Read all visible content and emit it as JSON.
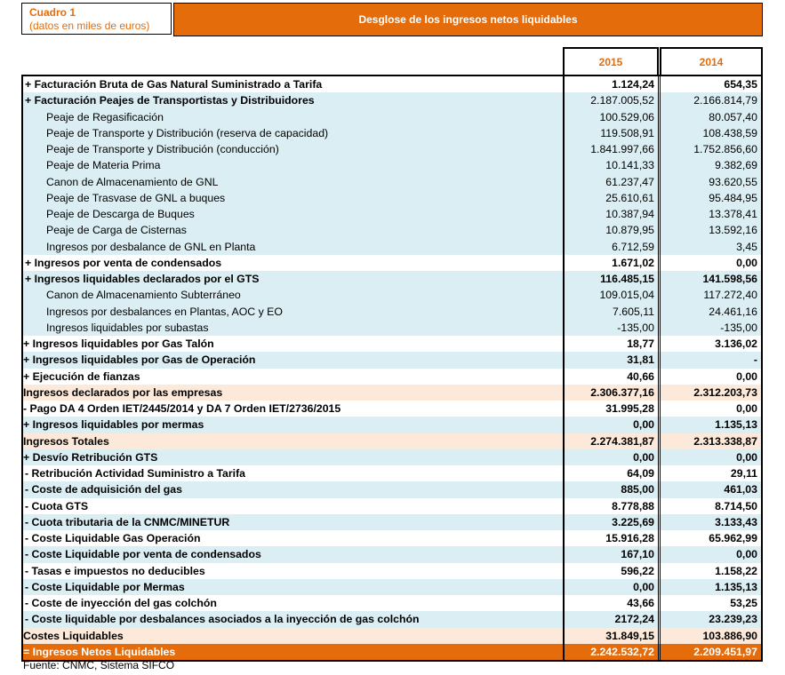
{
  "header": {
    "box_title": "Cuadro 1",
    "box_subtitle": "(datos en miles de euros)",
    "title": "Desglose de los ingresos netos liquidables"
  },
  "columns": [
    "2015",
    "2014"
  ],
  "rows": [
    {
      "label": "+ Facturación Bruta de Gas Natural Suministrado a Tarifa",
      "v2015": "1.124,24",
      "v2014": "654,35",
      "bold": true,
      "indent": 1,
      "bg": "white"
    },
    {
      "label": "+ Facturación Peajes de Transportistas y Distribuidores",
      "v2015": "2.187.005,52",
      "v2014": "2.166.814,79",
      "bold": true,
      "indent": 1,
      "bg": "blue",
      "vbold": false
    },
    {
      "label": "Peaje de Regasificación",
      "v2015": "100.529,06",
      "v2014": "80.057,40",
      "bold": false,
      "indent": 2,
      "bg": "blue"
    },
    {
      "label": "Peaje de Transporte y Distribución (reserva de capacidad)",
      "v2015": "119.508,91",
      "v2014": "108.438,59",
      "bold": false,
      "indent": 2,
      "bg": "blue"
    },
    {
      "label": "Peaje de Transporte y Distribución (conducción)",
      "v2015": "1.841.997,66",
      "v2014": "1.752.856,60",
      "bold": false,
      "indent": 2,
      "bg": "blue"
    },
    {
      "label": "Peaje de Materia Prima",
      "v2015": "10.141,33",
      "v2014": "9.382,69",
      "bold": false,
      "indent": 2,
      "bg": "blue"
    },
    {
      "label": "Canon de Almacenamiento de GNL",
      "v2015": "61.237,47",
      "v2014": "93.620,55",
      "bold": false,
      "indent": 2,
      "bg": "blue"
    },
    {
      "label": "Peaje de Trasvase de GNL a buques",
      "v2015": "25.610,61",
      "v2014": "95.484,95",
      "bold": false,
      "indent": 2,
      "bg": "blue"
    },
    {
      "label": "Peaje de Descarga de Buques",
      "v2015": "10.387,94",
      "v2014": "13.378,41",
      "bold": false,
      "indent": 2,
      "bg": "blue"
    },
    {
      "label": "Peaje de Carga de Cisternas",
      "v2015": "10.879,95",
      "v2014": "13.592,16",
      "bold": false,
      "indent": 2,
      "bg": "blue"
    },
    {
      "label": "Ingresos por desbalance de GNL en Planta",
      "v2015": "6.712,59",
      "v2014": "3,45",
      "bold": false,
      "indent": 2,
      "bg": "blue"
    },
    {
      "label": "+ Ingresos por venta de condensados",
      "v2015": "1.671,02",
      "v2014": "0,00",
      "bold": true,
      "indent": 1,
      "bg": "white"
    },
    {
      "label": "+ Ingresos liquidables declarados por el GTS",
      "v2015": "116.485,15",
      "v2014": "141.598,56",
      "bold": true,
      "indent": 1,
      "bg": "blue"
    },
    {
      "label": "Canon de Almacenamiento Subterráneo",
      "v2015": "109.015,04",
      "v2014": "117.272,40",
      "bold": false,
      "indent": 2,
      "bg": "blue"
    },
    {
      "label": "Ingresos por desbalances en Plantas, AOC y EO",
      "v2015": "7.605,11",
      "v2014": "24.461,16",
      "bold": false,
      "indent": 2,
      "bg": "blue"
    },
    {
      "label": "Ingresos liquidables por subastas",
      "v2015": "-135,00",
      "v2014": "-135,00",
      "bold": false,
      "indent": 2,
      "bg": "blue"
    },
    {
      "label": "+ Ingresos liquidables por Gas Talón",
      "v2015": "18,77",
      "v2014": "3.136,02",
      "bold": true,
      "indent": 0,
      "bg": "white"
    },
    {
      "label": "+ Ingresos liquidables por Gas de Operación",
      "v2015": "31,81",
      "v2014": "-",
      "bold": true,
      "indent": 0,
      "bg": "blue"
    },
    {
      "label": "+ Ejecución de fianzas",
      "v2015": "40,66",
      "v2014": "0,00",
      "bold": true,
      "indent": 0,
      "bg": "white"
    },
    {
      "label": "Ingresos declarados por las empresas",
      "v2015": "2.306.377,16",
      "v2014": "2.312.203,73",
      "bold": true,
      "indent": 0,
      "bg": "peach"
    },
    {
      "label": "- Pago DA 4 Orden IET/2445/2014 y DA 7 Orden IET/2736/2015",
      "v2015": "31.995,28",
      "v2014": "0,00",
      "bold": true,
      "indent": 0,
      "bg": "white"
    },
    {
      "label": "+ Ingresos liquidables por mermas",
      "v2015": "0,00",
      "v2014": "1.135,13",
      "bold": true,
      "indent": 0,
      "bg": "blue"
    },
    {
      "label": "Ingresos Totales",
      "v2015": "2.274.381,87",
      "v2014": "2.313.338,87",
      "bold": true,
      "indent": 0,
      "bg": "peach"
    },
    {
      "label": "+ Desvío Retribución GTS",
      "v2015": "0,00",
      "v2014": "0,00",
      "bold": true,
      "indent": 0,
      "bg": "blue"
    },
    {
      "label": "- Retribución Actividad Suministro a Tarifa",
      "v2015": "64,09",
      "v2014": "29,11",
      "bold": true,
      "indent": 1,
      "bg": "white"
    },
    {
      "label": "- Coste de adquisición del gas",
      "v2015": "885,00",
      "v2014": "461,03",
      "bold": true,
      "indent": 1,
      "bg": "blue"
    },
    {
      "label": "- Cuota GTS",
      "v2015": "8.778,88",
      "v2014": "8.714,50",
      "bold": true,
      "indent": 1,
      "bg": "white"
    },
    {
      "label": "- Cuota tributaria de la CNMC/MINETUR",
      "v2015": "3.225,69",
      "v2014": "3.133,43",
      "bold": true,
      "indent": 1,
      "bg": "blue"
    },
    {
      "label": "- Coste Liquidable Gas Operación",
      "v2015": "15.916,28",
      "v2014": "65.962,99",
      "bold": true,
      "indent": 1,
      "bg": "white"
    },
    {
      "label": "- Coste Liquidable por venta de condensados",
      "v2015": "167,10",
      "v2014": "0,00",
      "bold": true,
      "indent": 1,
      "bg": "blue"
    },
    {
      "label": "- Tasas e impuestos no deducibles",
      "v2015": "596,22",
      "v2014": "1.158,22",
      "bold": true,
      "indent": 1,
      "bg": "white"
    },
    {
      "label": "- Coste Liquidable por Mermas",
      "v2015": "0,00",
      "v2014": "1.135,13",
      "bold": true,
      "indent": 1,
      "bg": "blue"
    },
    {
      "label": "- Coste de inyección del gas colchón",
      "v2015": "43,66",
      "v2014": "53,25",
      "bold": true,
      "indent": 1,
      "bg": "white"
    },
    {
      "label": "- Coste liquidable por desbalances asociados a la inyección de gas colchón",
      "v2015": "2172,24",
      "v2014": "23.239,23",
      "bold": true,
      "indent": 1,
      "bg": "blue"
    },
    {
      "label": "Costes Liquidables",
      "v2015": "31.849,15",
      "v2014": "103.886,90",
      "bold": true,
      "indent": 0,
      "bg": "peach"
    },
    {
      "label": "= Ingresos Netos Liquidables",
      "v2015": "2.242.532,72",
      "v2014": "2.209.451,97",
      "bold": true,
      "indent": 0,
      "bg": "orange"
    }
  ],
  "footer": "Fuente: CNMC, Sistema SIFCO"
}
